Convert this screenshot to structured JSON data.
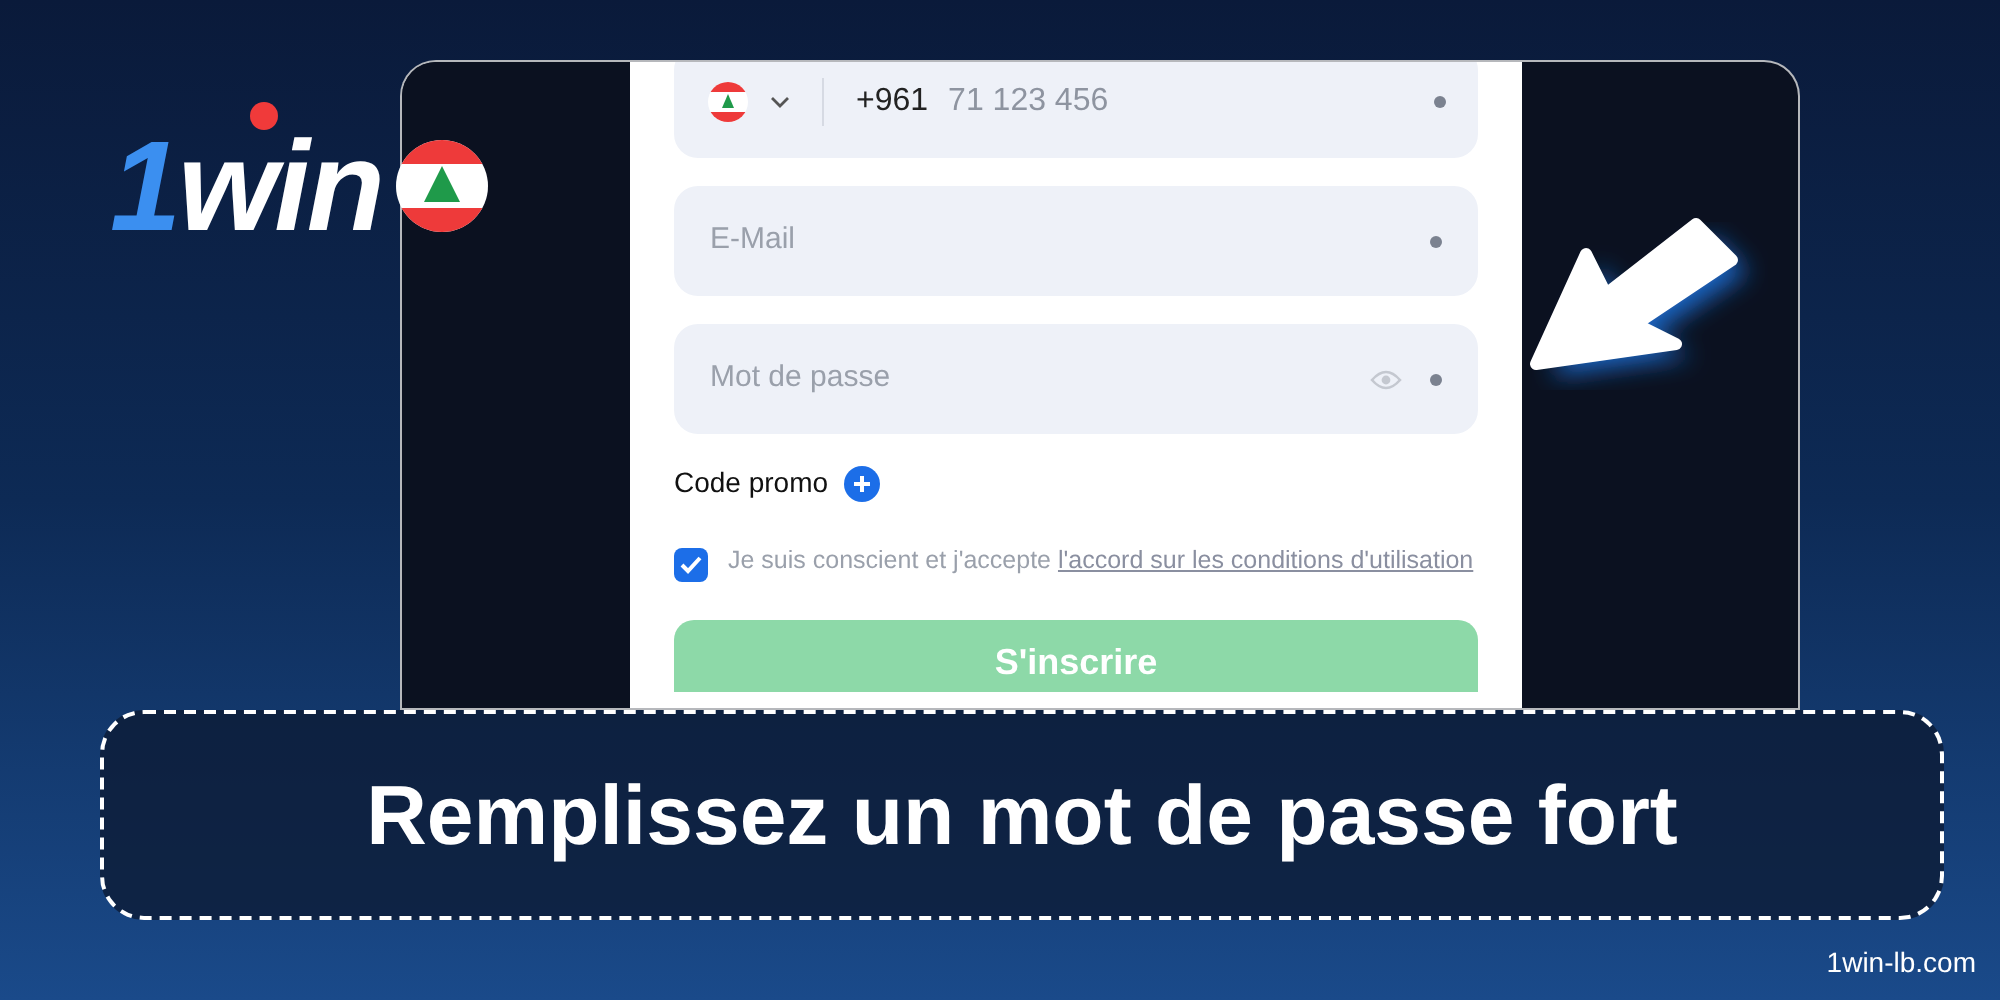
{
  "logo": {
    "digit": "1",
    "word": "win"
  },
  "form": {
    "phone": {
      "code": "+961",
      "placeholder": "71 123 456"
    },
    "fields": [
      {
        "kind": "text",
        "placeholder": "E-Mail"
      },
      {
        "kind": "password",
        "placeholder": "Mot de passe"
      }
    ],
    "promo": {
      "label": "Code promo",
      "expanded": false
    },
    "terms": {
      "checked": true,
      "text": "Je suis conscient et j'accepte",
      "link": "l'accord sur les conditions d'utilisation"
    },
    "submit": "S'inscrire"
  },
  "caption": "Remplissez un mot de passe fort",
  "site": "1win-lb.com"
}
